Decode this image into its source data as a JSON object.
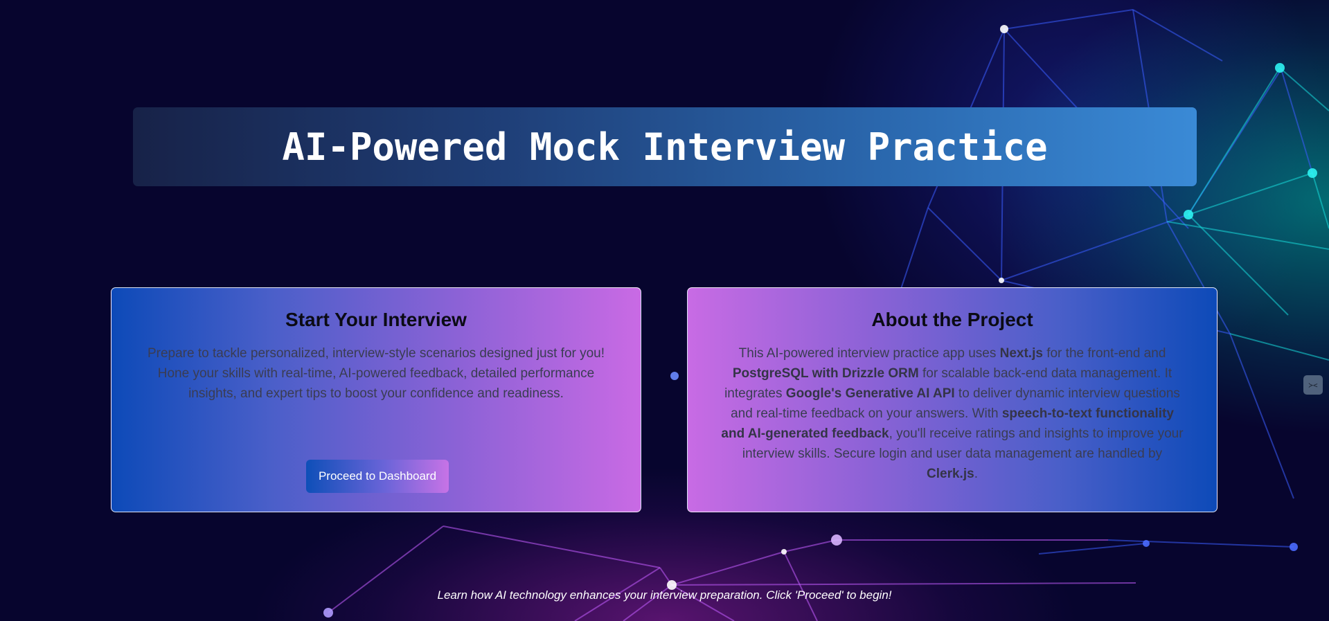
{
  "header": {
    "title": "AI-Powered Mock Interview Practice"
  },
  "start_card": {
    "heading": "Start Your Interview",
    "description": "Prepare to tackle personalized, interview-style scenarios designed just for you! Hone your skills with real-time, AI-powered feedback, detailed performance insights, and expert tips to boost your confidence and readiness.",
    "button_label": "Proceed to Dashboard"
  },
  "about_card": {
    "heading": "About the Project",
    "segments": [
      {
        "text": "This AI-powered interview practice app uses ",
        "bold": false
      },
      {
        "text": "Next.js",
        "bold": true
      },
      {
        "text": " for the front-end and ",
        "bold": false
      },
      {
        "text": "PostgreSQL with Drizzle ORM",
        "bold": true
      },
      {
        "text": " for scalable back-end data management. It integrates ",
        "bold": false
      },
      {
        "text": "Google's Generative AI API",
        "bold": true
      },
      {
        "text": " to deliver dynamic interview questions and real-time feedback on your answers. With ",
        "bold": false
      },
      {
        "text": "speech-to-text functionality and AI-generated feedback",
        "bold": true
      },
      {
        "text": ", you'll receive ratings and insights to improve your interview skills. Secure login and user data management are handled by ",
        "bold": false
      },
      {
        "text": "Clerk.js",
        "bold": true
      },
      {
        "text": ".",
        "bold": false
      }
    ]
  },
  "footer": {
    "note": "Learn how AI technology enhances your interview preparation. Click 'Proceed' to begin!"
  },
  "side_widget": {
    "icon": "extension-icon",
    "glyph": "≻<"
  },
  "colors": {
    "background": "#07052e",
    "accent_blue": "#0d4ab8",
    "accent_pink": "#c96ae4",
    "teal_glow": "#00beaa"
  }
}
